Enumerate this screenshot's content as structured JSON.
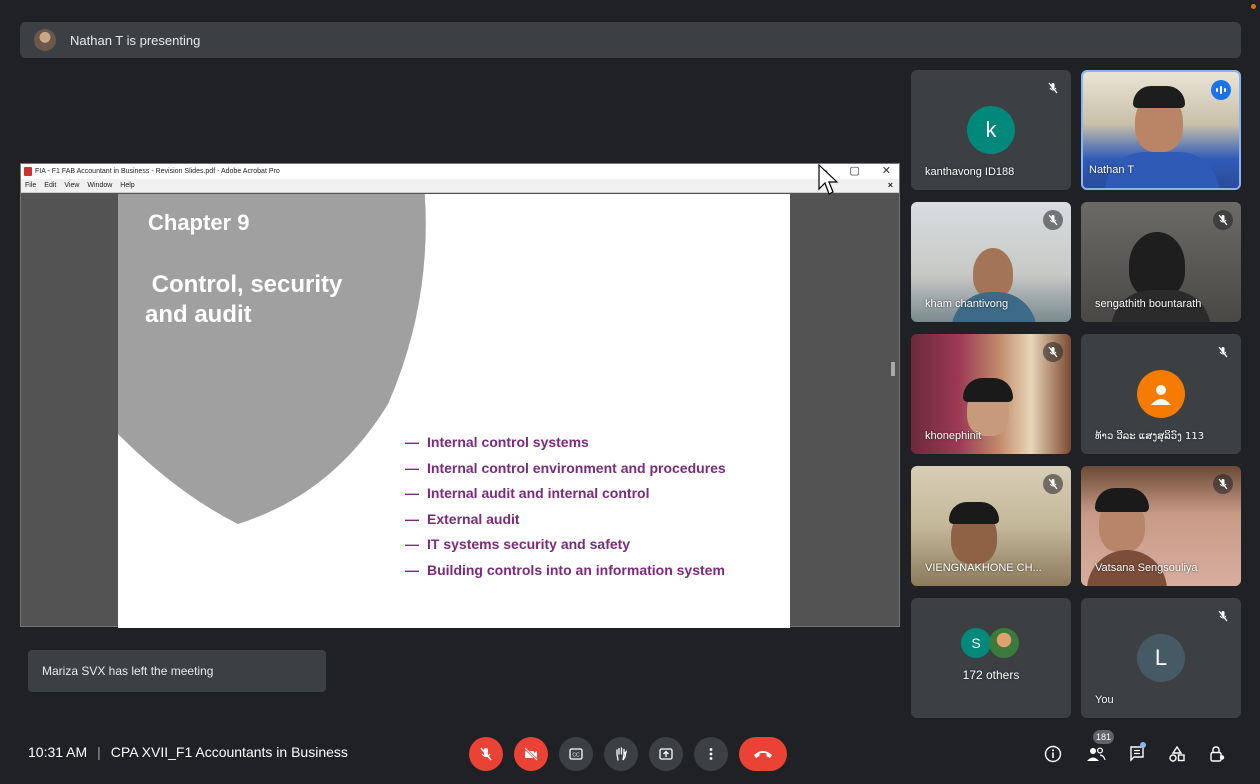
{
  "header": {
    "presenting_text": "Nathan T is presenting"
  },
  "acrobat": {
    "window_title": "FIA - F1 FAB Accountant in Business - Revision Slides.pdf - Adobe Acrobat Pro",
    "menu": [
      "File",
      "Edit",
      "View",
      "Window",
      "Help"
    ],
    "menu_close": "×",
    "window_controls": [
      "–",
      "▢",
      "✕"
    ]
  },
  "slide": {
    "chapter": "Chapter 9",
    "title": " Control, security\nand audit",
    "bullet_dash": "—",
    "bullets": [
      "Internal control systems",
      "Internal control environment and procedures",
      "Internal audit and internal control",
      "External audit",
      "IT systems security and safety",
      "Building controls into an information system"
    ]
  },
  "toast": {
    "text": "Mariza SVX has left the meeting"
  },
  "participants": [
    {
      "name": "kanthavong ID188",
      "initial": "k",
      "avatar_color": "#00897b",
      "muted": true
    },
    {
      "name": "Nathan T",
      "speaking": true
    },
    {
      "name": "kham chantivong",
      "muted": true
    },
    {
      "name": "sengathith bountarath",
      "muted": true
    },
    {
      "name": "khonephinit",
      "muted": true
    },
    {
      "name": "ທ້າວ ວີລະ ແສງສຸລິວົງ 113",
      "avatar_color": "#f57c00",
      "muted": true
    },
    {
      "name": "VIENGNAKHONE CH...",
      "muted": true
    },
    {
      "name": "Vatsana Sengsouliya",
      "muted": true
    },
    {
      "name": "172 others",
      "initial": "S",
      "avatar_color": "#00897b"
    },
    {
      "name": "You",
      "initial": "L",
      "avatar_color": "#455a64",
      "muted": true
    }
  ],
  "footer": {
    "time": "10:31 AM",
    "separator": "|",
    "meeting_name": "CPA XVII_F1 Accountants in Business",
    "participant_count": "181"
  },
  "colors": {
    "background": "#202124",
    "tile": "#3c4043",
    "danger": "#ea4335",
    "slide_accent": "#7b2a7d",
    "shield_grey": "#a0a0a0"
  }
}
